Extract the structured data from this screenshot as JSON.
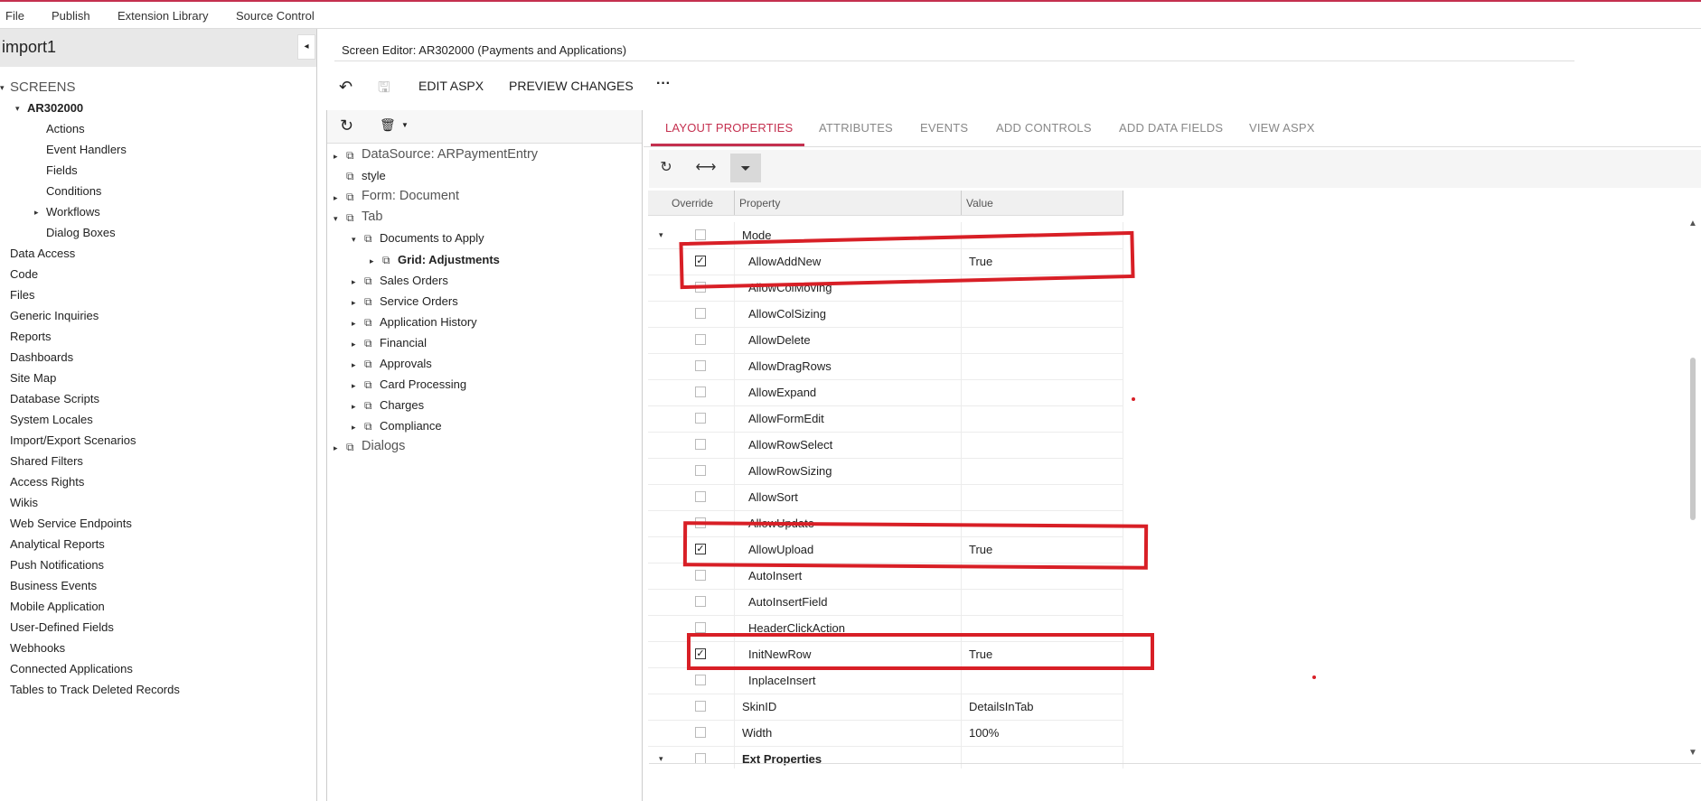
{
  "menu": [
    "File",
    "Publish",
    "Extension Library",
    "Source Control"
  ],
  "project": {
    "title": "import1",
    "collapse_icon": "◂"
  },
  "left_tree": {
    "screens_label": "SCREENS",
    "screen_id": "AR302000",
    "screen_children": [
      "Actions",
      "Event Handlers",
      "Fields",
      "Conditions",
      "Workflows",
      "Dialog Boxes"
    ],
    "sections": [
      "Data Access",
      "Code",
      "Files",
      "Generic Inquiries",
      "Reports",
      "Dashboards",
      "Site Map",
      "Database Scripts",
      "System Locales",
      "Import/Export Scenarios",
      "Shared Filters",
      "Access Rights",
      "Wikis",
      "Web Service Endpoints",
      "Analytical Reports",
      "Push Notifications",
      "Business Events",
      "Mobile Application",
      "User-Defined Fields",
      "Webhooks",
      "Connected Applications",
      "Tables to Track Deleted Records"
    ]
  },
  "editor": {
    "title": "Screen Editor: AR302000 (Payments and Applications)",
    "toolbar": {
      "undo_icon": "↶",
      "save_icon": "🖫",
      "edit_aspx": "EDIT ASPX",
      "preview_changes": "PREVIEW CHANGES",
      "more": "···"
    }
  },
  "control_tree": {
    "toolbar": {
      "refresh_icon": "↻",
      "delete_icon": "🗑"
    },
    "nodes": [
      {
        "label": "DataSource: ARPaymentEntry",
        "level": 0,
        "caret": "▸",
        "style": "large"
      },
      {
        "label": "style",
        "level": 0,
        "caret": "",
        "style": "normal"
      },
      {
        "label": "Form: Document",
        "level": 0,
        "caret": "▸",
        "style": "large"
      },
      {
        "label": "Tab",
        "level": 0,
        "caret": "▾",
        "style": "large"
      },
      {
        "label": "Documents to Apply",
        "level": 1,
        "caret": "▾",
        "style": "normal"
      },
      {
        "label": "Grid: Adjustments",
        "level": 2,
        "caret": "▸",
        "style": "bold"
      },
      {
        "label": "Sales Orders",
        "level": 1,
        "caret": "▸",
        "style": "normal"
      },
      {
        "label": "Service Orders",
        "level": 1,
        "caret": "▸",
        "style": "normal"
      },
      {
        "label": "Application History",
        "level": 1,
        "caret": "▸",
        "style": "normal"
      },
      {
        "label": "Financial",
        "level": 1,
        "caret": "▸",
        "style": "normal"
      },
      {
        "label": "Approvals",
        "level": 1,
        "caret": "▸",
        "style": "normal"
      },
      {
        "label": "Card Processing",
        "level": 1,
        "caret": "▸",
        "style": "normal"
      },
      {
        "label": "Charges",
        "level": 1,
        "caret": "▸",
        "style": "normal"
      },
      {
        "label": "Compliance",
        "level": 1,
        "caret": "▸",
        "style": "normal"
      },
      {
        "label": "Dialogs",
        "level": 0,
        "caret": "▸",
        "style": "large"
      }
    ]
  },
  "tabs": [
    "LAYOUT PROPERTIES",
    "ATTRIBUTES",
    "EVENTS",
    "ADD CONTROLS",
    "ADD DATA FIELDS",
    "VIEW ASPX"
  ],
  "props_toolbar": {
    "refresh_icon": "↻",
    "fit_icon": "⟷",
    "filter_icon": "⏷"
  },
  "grid": {
    "headers": {
      "override": "Override",
      "property": "Property",
      "value": "Value"
    },
    "rows": [
      {
        "name": "Mode",
        "value": "",
        "checked": false,
        "group": true,
        "indent": 0
      },
      {
        "name": "AllowAddNew",
        "value": "True",
        "checked": true,
        "indent": 1
      },
      {
        "name": "AllowColMoving",
        "value": "",
        "checked": false,
        "indent": 1
      },
      {
        "name": "AllowColSizing",
        "value": "",
        "checked": false,
        "indent": 1
      },
      {
        "name": "AllowDelete",
        "value": "",
        "checked": false,
        "indent": 1
      },
      {
        "name": "AllowDragRows",
        "value": "",
        "checked": false,
        "indent": 1
      },
      {
        "name": "AllowExpand",
        "value": "",
        "checked": false,
        "indent": 1
      },
      {
        "name": "AllowFormEdit",
        "value": "",
        "checked": false,
        "indent": 1
      },
      {
        "name": "AllowRowSelect",
        "value": "",
        "checked": false,
        "indent": 1
      },
      {
        "name": "AllowRowSizing",
        "value": "",
        "checked": false,
        "indent": 1
      },
      {
        "name": "AllowSort",
        "value": "",
        "checked": false,
        "indent": 1
      },
      {
        "name": "AllowUpdate",
        "value": "",
        "checked": false,
        "indent": 1
      },
      {
        "name": "AllowUpload",
        "value": "True",
        "checked": true,
        "indent": 1
      },
      {
        "name": "AutoInsert",
        "value": "",
        "checked": false,
        "indent": 1
      },
      {
        "name": "AutoInsertField",
        "value": "",
        "checked": false,
        "indent": 1
      },
      {
        "name": "HeaderClickAction",
        "value": "",
        "checked": false,
        "indent": 1
      },
      {
        "name": "InitNewRow",
        "value": "True",
        "checked": true,
        "indent": 1
      },
      {
        "name": "InplaceInsert",
        "value": "",
        "checked": false,
        "indent": 1
      },
      {
        "name": "SkinID",
        "value": "DetailsInTab",
        "checked": false,
        "indent": 0
      },
      {
        "name": "Width",
        "value": "100%",
        "checked": false,
        "indent": 0
      },
      {
        "name": "Ext Properties",
        "value": "",
        "checked": false,
        "group": true,
        "indent": 0
      }
    ]
  },
  "colors": {
    "accent": "#c4304f",
    "highlight": "#d81f26"
  }
}
